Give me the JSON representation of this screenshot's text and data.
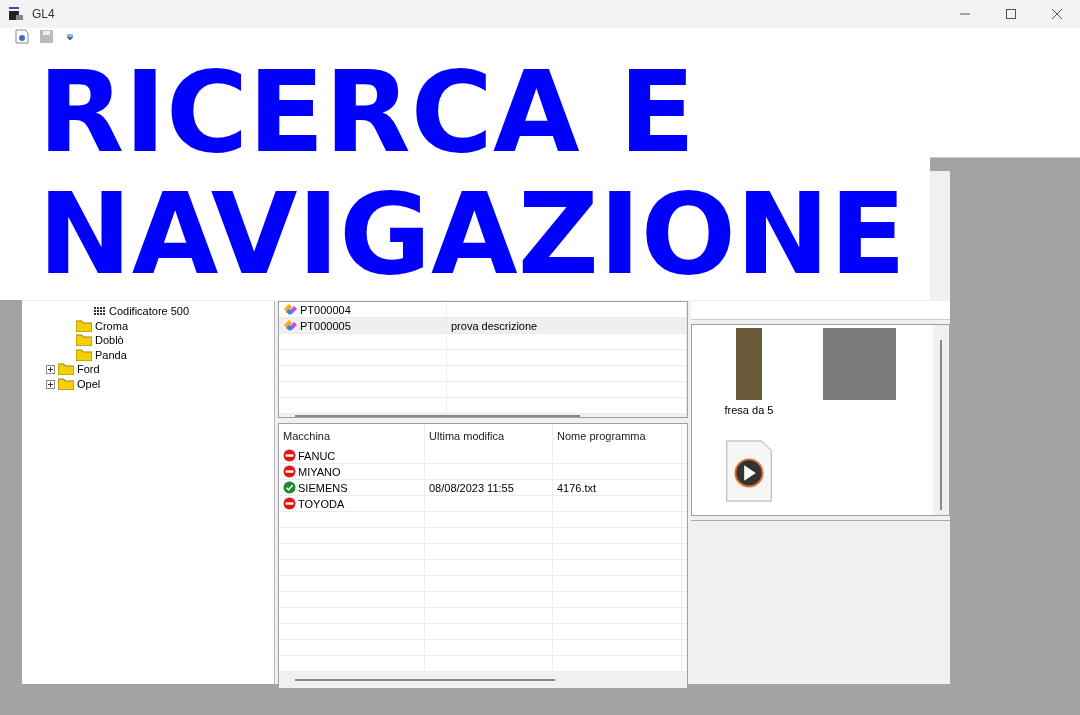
{
  "window": {
    "title": "GL4"
  },
  "toolbar": [
    {
      "kind": "settings",
      "disabled": false
    },
    {
      "kind": "save",
      "disabled": true
    },
    {
      "kind": "dropdown",
      "disabled": false
    }
  ],
  "overlay_title": [
    "RICERCA E",
    "NAVIGAZIONE"
  ],
  "tree": [
    {
      "kind": "group",
      "children": [
        {
          "kind": "group",
          "children": [
            {
              "label": "Codificatore 500",
              "kind": "device"
            }
          ]
        },
        {
          "label": "Croma",
          "kind": "folder"
        },
        {
          "label": "Doblò",
          "kind": "folder"
        },
        {
          "label": "Panda",
          "kind": "folder"
        }
      ]
    },
    {
      "label": "Ford",
      "kind": "folder",
      "expanded": false
    },
    {
      "label": "Opel",
      "kind": "folder",
      "expanded": false
    }
  ],
  "parts_list": {
    "rows": [
      {
        "code": "PT000004",
        "selected": false
      },
      {
        "code": "PT000005",
        "description": "prova descrizione",
        "selected": true
      }
    ]
  },
  "machines": {
    "columns": [
      "Macchina",
      "Ultima modifica",
      "Nome programma"
    ],
    "rows": [
      {
        "machine": "FANUC",
        "available": false
      },
      {
        "machine": "MIYANO",
        "available": false
      },
      {
        "machine": "SIEMENS",
        "available": true,
        "modified": "08/08/2023 11:55",
        "program": "4176.txt"
      },
      {
        "machine": "TOYODA",
        "available": false
      }
    ]
  },
  "attachments": [
    {
      "kind": "tool-photo",
      "caption": "fresa da 5"
    },
    {
      "kind": "machine-photo"
    },
    {
      "kind": "video-file"
    }
  ]
}
